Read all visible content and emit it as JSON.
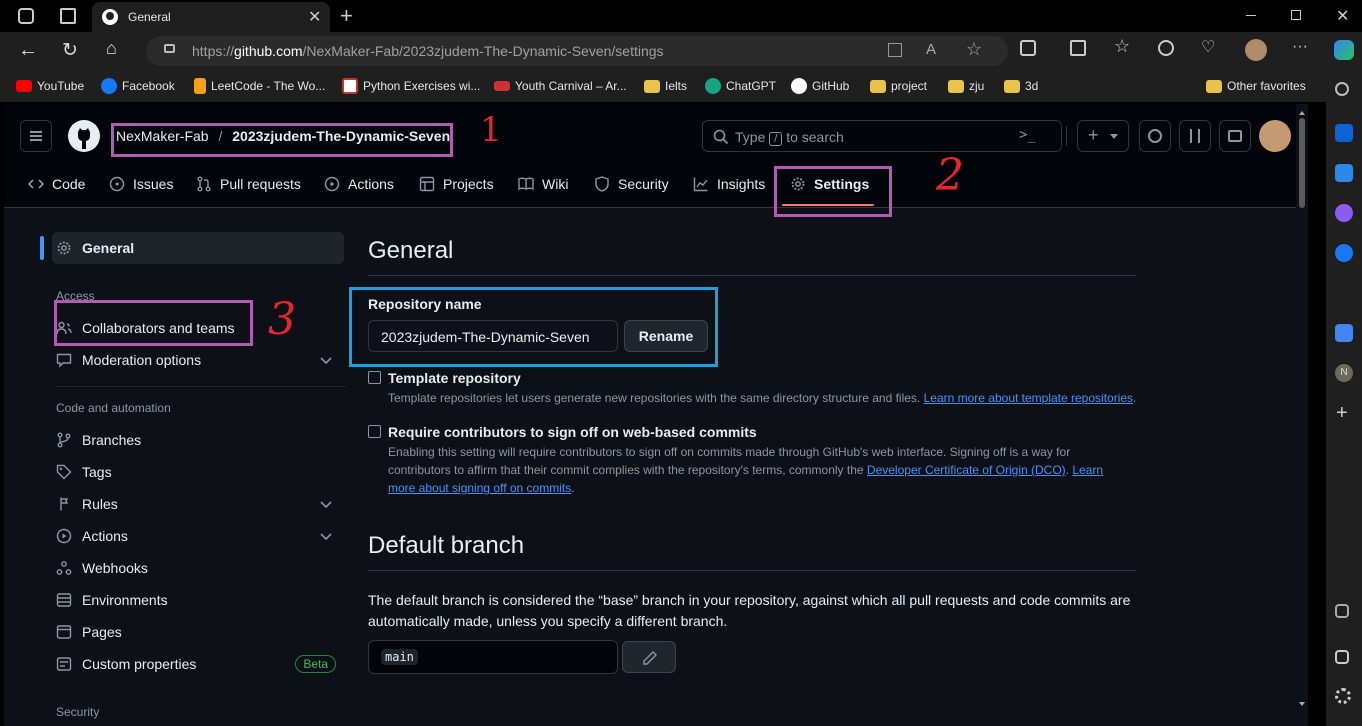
{
  "browser": {
    "tab_title": "General",
    "url_prefix": "https://",
    "url_host": "github.com",
    "url_path": "/NexMaker-Fab/2023zjudem-The-Dynamic-Seven/settings",
    "favorites": [
      {
        "label": "YouTube",
        "color": "#ff0000"
      },
      {
        "label": "Facebook",
        "color": "#1877f2"
      },
      {
        "label": "LeetCode - The Wo...",
        "color": "#f89f1b"
      },
      {
        "label": "Python Exercises wi...",
        "color": "#c0392b"
      },
      {
        "label": "Youth Carnival – Ar...",
        "color": "#cc3333"
      },
      {
        "label": "Ielts",
        "color": "#e8c24a"
      },
      {
        "label": "ChatGPT",
        "color": "#19a37f"
      },
      {
        "label": "GitHub",
        "color": "#ffffff"
      },
      {
        "label": "project",
        "color": "#e8c24a"
      },
      {
        "label": "zju",
        "color": "#e8c24a"
      },
      {
        "label": "3d",
        "color": "#e8c24a"
      }
    ],
    "other_favorites": "Other favorites",
    "rail_letter": "N"
  },
  "header": {
    "owner": "NexMaker-Fab",
    "separator": "/",
    "repo": "2023zjudem-The-Dynamic-Seven",
    "search_prefix": "Type",
    "search_key": "/",
    "search_suffix": "to search",
    "plus": "+"
  },
  "repo_tabs": [
    "Code",
    "Issues",
    "Pull requests",
    "Actions",
    "Projects",
    "Wiki",
    "Security",
    "Insights",
    "Settings"
  ],
  "sidebar": {
    "general": "General",
    "access_heading": "Access",
    "collaborators": "Collaborators and teams",
    "moderation": "Moderation options",
    "code_heading": "Code and automation",
    "branches": "Branches",
    "tags": "Tags",
    "rules": "Rules",
    "actions": "Actions",
    "webhooks": "Webhooks",
    "environments": "Environments",
    "pages": "Pages",
    "custom_properties": "Custom properties",
    "beta": "Beta",
    "security_heading": "Security"
  },
  "main": {
    "title": "General",
    "repo_name_label": "Repository name",
    "repo_name_value": "2023zjudem-The-Dynamic-Seven",
    "rename": "Rename",
    "template_label": "Template repository",
    "template_desc": "Template repositories let users generate new repositories with the same directory structure and files.",
    "template_link": "Learn more about template repositories",
    "period": ".",
    "signoff_label": "Require contributors to sign off on web-based commits",
    "signoff_desc1": "Enabling this setting will require contributors to sign off on commits made through GitHub's web interface. Signing off is a way for",
    "signoff_desc2": "contributors to affirm that their commit complies with the repository's terms, commonly the",
    "signoff_link1": "Developer Certificate of Origin (DCO)",
    "signoff_link2a": "Learn",
    "signoff_link2b": "more about signing off on commits",
    "default_branch_title": "Default branch",
    "default_branch_desc1": "The default branch is considered the “base” branch in your repository, against which all pull requests and code commits are",
    "default_branch_desc2": "automatically made, unless you specify a different branch.",
    "branch_value": "main"
  },
  "annotations": {
    "one": "1",
    "two": "2",
    "three": "3"
  }
}
